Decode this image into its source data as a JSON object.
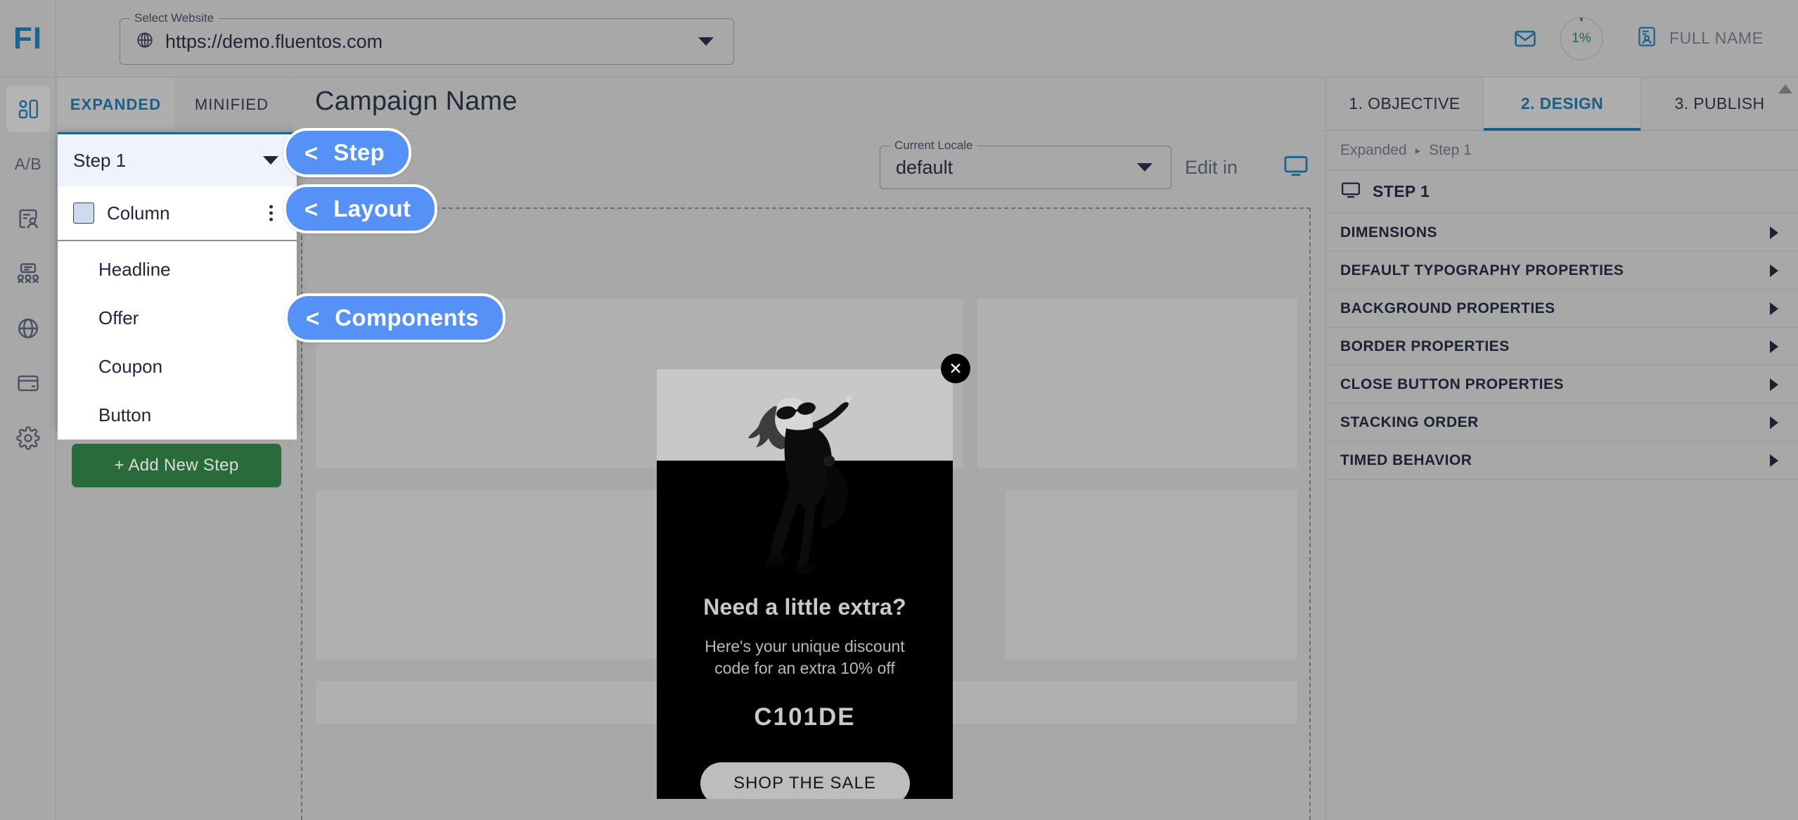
{
  "brand": {
    "logo_text": "FI",
    "accent": "#1a6490",
    "callout_blue": "#5691f7",
    "add_step_green": "#2a6b3c"
  },
  "rail": {
    "items": [
      {
        "name": "campaigns-icon",
        "label": ""
      },
      {
        "name": "ab-test-icon",
        "label": "A/B"
      },
      {
        "name": "audience-icon",
        "label": ""
      },
      {
        "name": "segments-icon",
        "label": ""
      },
      {
        "name": "globe-icon",
        "label": ""
      },
      {
        "name": "billing-icon",
        "label": ""
      },
      {
        "name": "settings-icon",
        "label": ""
      }
    ]
  },
  "topbar": {
    "website_select": {
      "legend": "Select Website",
      "value": "https://demo.fluentos.com"
    }
  },
  "header_right": {
    "progress_percent": "1%",
    "user_name": "FULL NAME"
  },
  "editor": {
    "tabs": [
      {
        "label": "EXPANDED",
        "active": true
      },
      {
        "label": "MINIFIED",
        "active": false
      }
    ],
    "campaign_name": "Campaign Name",
    "add_new_step": "+ Add New Step"
  },
  "layers_popup": {
    "step_select_value": "Step 1",
    "layout_item": {
      "label": "Column"
    },
    "components": [
      {
        "label": "Headline"
      },
      {
        "label": "Offer"
      },
      {
        "label": "Coupon"
      },
      {
        "label": "Button"
      }
    ]
  },
  "callouts": [
    {
      "chevron": "<",
      "label": "Step"
    },
    {
      "chevron": "<",
      "label": "Layout"
    },
    {
      "chevron": "<",
      "label": "Components"
    }
  ],
  "canvas_toolbar": {
    "locale_select": {
      "legend": "Current Locale",
      "value": "default"
    },
    "edit_in_label": "Edit in"
  },
  "creative": {
    "headline": "Need a little extra?",
    "subtext": "Here's your unique discount code for an extra 10% off",
    "coupon_code": "C101DE",
    "cta_label": "SHOP THE SALE",
    "close_glyph": "✕"
  },
  "right_panel": {
    "wizard_tabs": [
      {
        "label": "1. OBJECTIVE",
        "active": false
      },
      {
        "label": "2. DESIGN",
        "active": true
      },
      {
        "label": "3. PUBLISH",
        "active": false
      }
    ],
    "breadcrumb": {
      "root": "Expanded",
      "separator": "▸",
      "current": "Step 1"
    },
    "step_title": "STEP 1",
    "sections": [
      {
        "label": "DIMENSIONS"
      },
      {
        "label": "DEFAULT TYPOGRAPHY PROPERTIES"
      },
      {
        "label": "BACKGROUND PROPERTIES"
      },
      {
        "label": "BORDER PROPERTIES"
      },
      {
        "label": "CLOSE BUTTON PROPERTIES"
      },
      {
        "label": "STACKING ORDER"
      },
      {
        "label": "TIMED BEHAVIOR"
      }
    ]
  }
}
